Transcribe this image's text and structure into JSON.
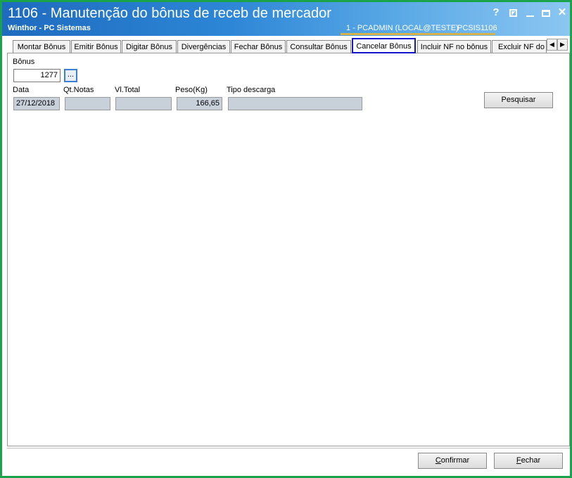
{
  "window": {
    "title": "1106 - Manutenção do bônus de receb de mercador",
    "subtitle": "Winthor - PC Sistemas",
    "user_info": "1 - PCADMIN (LOCAL@TESTE)",
    "program_id": "PCSIS1106",
    "controls": {
      "help": "?",
      "close": "✕"
    }
  },
  "tabs": [
    {
      "label": "Montar Bônus"
    },
    {
      "label": "Emitir Bônus"
    },
    {
      "label": "Digitar Bônus"
    },
    {
      "label": "Divergências"
    },
    {
      "label": "Fechar Bônus"
    },
    {
      "label": "Consultar Bônus"
    },
    {
      "label": "Cancelar Bônus"
    },
    {
      "label": "Incluir NF no bônus"
    },
    {
      "label": "Excluir NF do b"
    }
  ],
  "tab_scroll": {
    "left_icon": "arrow-left-icon",
    "right_icon": "arrow-right-icon",
    "left": "◀",
    "right": "▶"
  },
  "form": {
    "bonus_label": "Bônus",
    "bonus_value": "1277",
    "lookup_button": "...",
    "data_label": "Data",
    "data_value": "27/12/2018",
    "qt_notas_label": "Qt.Notas",
    "qt_notas_value": "",
    "vl_total_label": "Vl.Total",
    "vl_total_value": "",
    "peso_label": "Peso(Kg)",
    "peso_value": "166,65",
    "tipo_descarga_label": "Tipo descarga",
    "tipo_descarga_value": "",
    "pesquisar_button": "Pesquisar"
  },
  "footer": {
    "confirmar_first": "C",
    "confirmar_rest": "onfirmar",
    "fechar_first": "F",
    "fechar_rest": "echar"
  },
  "colors": {
    "title_gradient_start": "#1e6bbf",
    "title_gradient_end": "#8cc6f2",
    "window_border": "#1aa34a",
    "active_tab_border": "#1515d0",
    "readonly_field": "#c8d0da"
  }
}
